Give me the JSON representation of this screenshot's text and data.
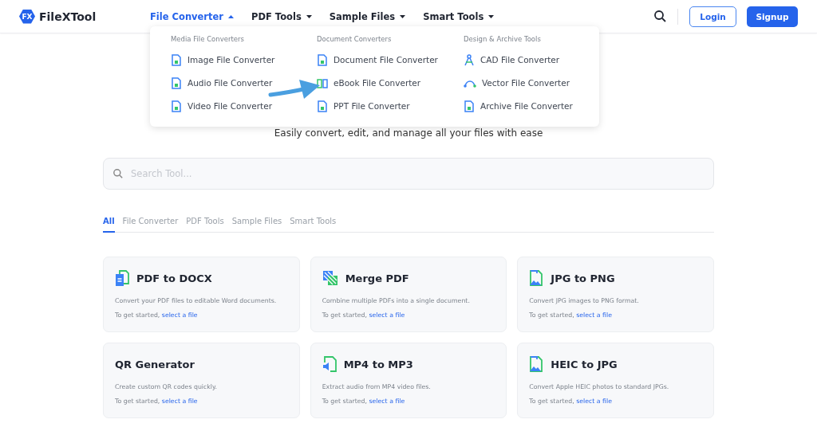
{
  "brand": {
    "badge": "FX",
    "name": "FileXTool"
  },
  "nav": [
    {
      "label": "File Converter",
      "expanded": true
    },
    {
      "label": "PDF Tools",
      "expanded": false
    },
    {
      "label": "Sample Files",
      "expanded": false
    },
    {
      "label": "Smart Tools",
      "expanded": false
    }
  ],
  "header_buttons": {
    "login": "Login",
    "signup": "Signup"
  },
  "dropdown": {
    "columns": [
      {
        "title": "Media File Converters",
        "items": [
          {
            "label": "Image File Converter",
            "kind": "file"
          },
          {
            "label": "Audio File Converter",
            "kind": "file"
          },
          {
            "label": "Video File Converter",
            "kind": "file"
          }
        ]
      },
      {
        "title": "Document Converters",
        "items": [
          {
            "label": "Document File Converter",
            "kind": "file"
          },
          {
            "label": "eBook File Converter",
            "kind": "book"
          },
          {
            "label": "PPT File Converter",
            "kind": "file"
          }
        ]
      },
      {
        "title": "Design & Archive Tools",
        "items": [
          {
            "label": "CAD File Converter",
            "kind": "compass"
          },
          {
            "label": "Vector File Converter",
            "kind": "vector"
          },
          {
            "label": "Archive File Converter",
            "kind": "file"
          }
        ]
      }
    ]
  },
  "subtitle": "Easily convert, edit, and manage all your files with ease",
  "search": {
    "placeholder": "Search Tool..."
  },
  "tabs": [
    {
      "label": "All",
      "selected": true
    },
    {
      "label": "File Converter",
      "selected": false
    },
    {
      "label": "PDF Tools",
      "selected": false
    },
    {
      "label": "Sample Files",
      "selected": false
    },
    {
      "label": "Smart Tools",
      "selected": false
    }
  ],
  "cards": [
    {
      "kind": "document",
      "title": "PDF to DOCX",
      "description": "Convert your PDF files to editable Word documents.",
      "prompt": "To get started,",
      "link": "select a file"
    },
    {
      "kind": "merge",
      "title": "Merge PDF",
      "description": "Combine multiple PDFs into a single document.",
      "prompt": "To get started,",
      "link": "select a file"
    },
    {
      "kind": "image",
      "title": "JPG to PNG",
      "description": "Convert JPG images to PNG format.",
      "prompt": "To get started,",
      "link": "select a file"
    },
    {
      "kind": "plain",
      "title": "QR Generator",
      "description": "Create custom QR codes quickly.",
      "prompt": "To get started,",
      "link": "select a file"
    },
    {
      "kind": "audio",
      "title": "MP4 to MP3",
      "description": "Extract audio from MP4 video files.",
      "prompt": "To get started,",
      "link": "select a file"
    },
    {
      "kind": "image",
      "title": "HEIC to JPG",
      "description": "Convert Apple HEIC photos to standard JPGs.",
      "prompt": "To get started,",
      "link": "select a file"
    }
  ]
}
